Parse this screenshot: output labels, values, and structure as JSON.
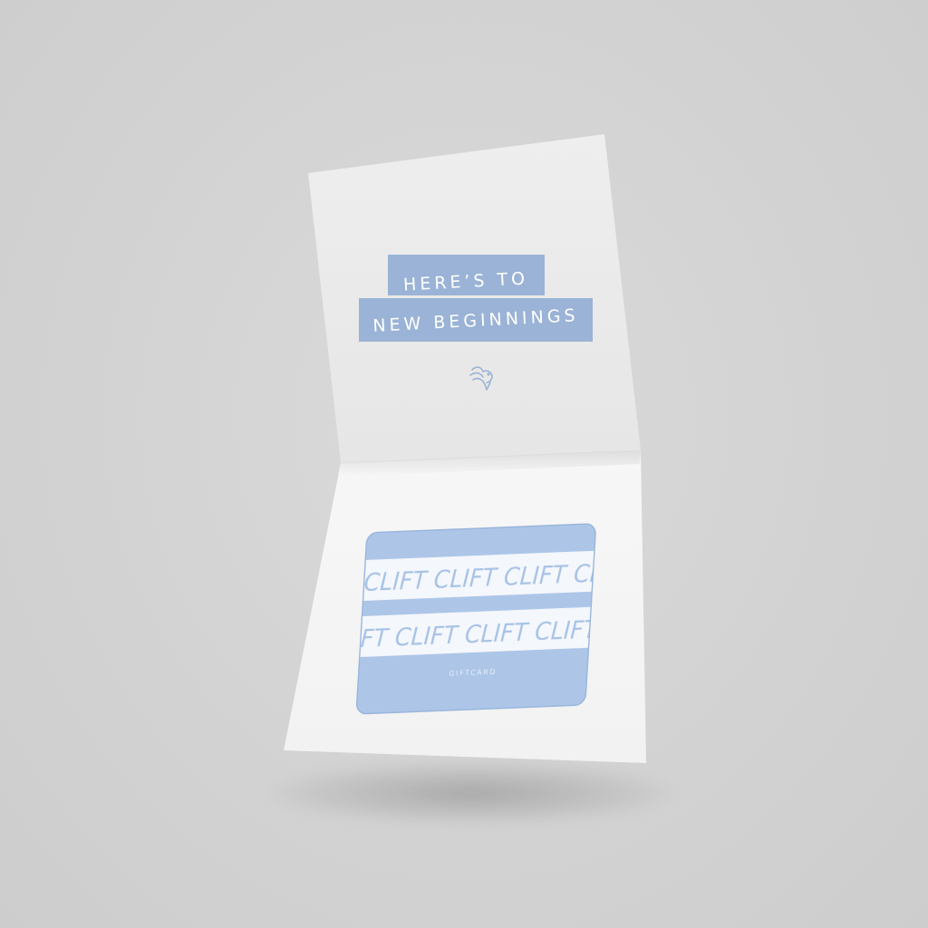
{
  "card": {
    "line1": "HERE’S TO",
    "line2": "NEW BEGINNINGS",
    "logo_icon": "bird-logo-icon"
  },
  "giftcard": {
    "brand_row1": "CLIFT CLIFT CLIFT CLI",
    "brand_row2": "IFT CLIFT CLIFT CLIFT",
    "label": "GIFTCARD"
  },
  "colors": {
    "background": "#d3d3d3",
    "paper_top": "#ebebeb",
    "paper_bottom": "#f6f6f6",
    "accent_blue": "#9ab3d6",
    "giftcard_blue": "#adc6e8"
  }
}
